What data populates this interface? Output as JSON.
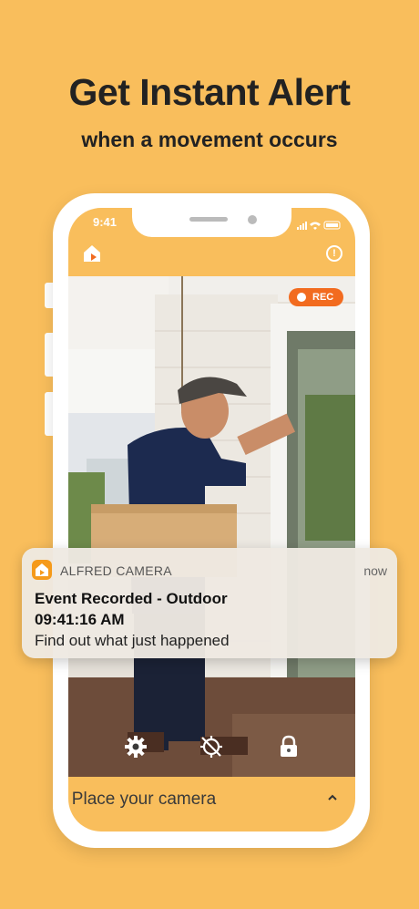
{
  "headline": "Get Instant Alert",
  "subheadline": "when a movement occurs",
  "status": {
    "time": "9:41"
  },
  "camera": {
    "rec_label": "REC"
  },
  "notification": {
    "app": "ALFRED CAMERA",
    "time": "now",
    "title": "Event Recorded - Outdoor",
    "timestamp": "09:41:16 AM",
    "body": "Find out what just happened"
  },
  "bottom": {
    "label": "Place your camera"
  },
  "colors": {
    "background": "#F9BE5C",
    "rec": "#F26B1F",
    "app_icon": "#F59A1B"
  }
}
